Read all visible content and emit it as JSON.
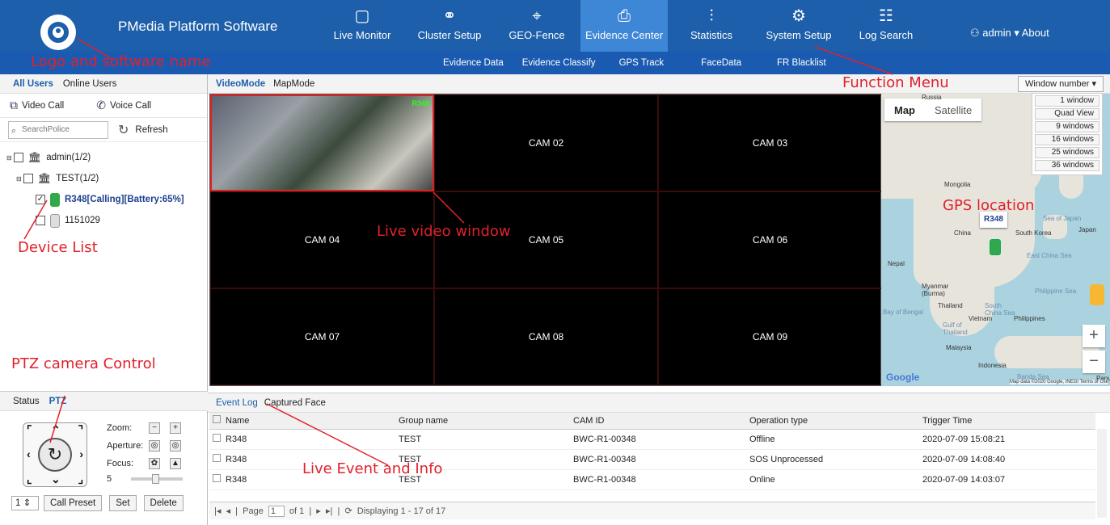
{
  "header": {
    "app_title": "PMedia Platform Software",
    "nav": [
      {
        "label": "Live Monitor",
        "icon": "monitor-icon",
        "glyph": "▢"
      },
      {
        "label": "Cluster Setup",
        "icon": "cluster-icon",
        "glyph": "⚭"
      },
      {
        "label": "GEO-Fence",
        "icon": "geofence-icon",
        "glyph": "⌖"
      },
      {
        "label": "Evidence Center",
        "icon": "evidence-icon",
        "glyph": "⎙"
      },
      {
        "label": "Statistics",
        "icon": "statistics-icon",
        "glyph": "⫶"
      },
      {
        "label": "System Setup",
        "icon": "gear-icon",
        "glyph": "⚙"
      },
      {
        "label": "Log Search",
        "icon": "log-icon",
        "glyph": "☷"
      }
    ],
    "active_nav": "Evidence Center",
    "user": "admin",
    "about": "About",
    "subnav": [
      "Evidence Data",
      "Evidence Classify",
      "GPS Track",
      "FaceData",
      "FR Blacklist"
    ]
  },
  "annotations": {
    "logo": "Logo and software name",
    "function_menu": "Function Menu",
    "device_list": "Device List",
    "live_video": "Live video window",
    "gps": "GPS location",
    "ptz": "PTZ camera Control",
    "event": "Live Event and Info"
  },
  "left": {
    "tabs": [
      "All Users",
      "Online Users"
    ],
    "video_call": "Video Call",
    "voice_call": "Voice Call",
    "search_placeholder": "SearchPolice",
    "refresh": "Refresh",
    "tree": {
      "root": "admin(1/2)",
      "group": "TEST(1/2)",
      "device1": "R348[Calling][Battery:65%]",
      "device2": "1151029"
    },
    "ptz_tabs": [
      "Status",
      "PTZ"
    ],
    "ptz": {
      "zoom": "Zoom:",
      "aperture": "Aperture:",
      "focus": "Focus:",
      "speed": "5",
      "preset": "1",
      "call_preset": "Call Preset",
      "set": "Set",
      "delete": "Delete"
    }
  },
  "center": {
    "modes": [
      "VideoMode",
      "MapMode"
    ],
    "window_number": "Window number",
    "window_options": [
      "1 window",
      "Quad View",
      "9 windows",
      "16 windows",
      "25 windows",
      "36 windows"
    ],
    "video_label": "R348",
    "cams": [
      "CAM 02",
      "CAM 03",
      "CAM 04",
      "CAM 05",
      "CAM 06",
      "CAM 07",
      "CAM 08",
      "CAM 09"
    ],
    "map": {
      "tabs": [
        "Map",
        "Satellite"
      ],
      "marker": "R348",
      "labels": [
        "Russia",
        "Mongolia",
        "China",
        "South Korea",
        "Japan",
        "Nepal",
        "Myanmar (Burma)",
        "Thailand",
        "Vietnam",
        "Philippines",
        "Malaysia",
        "Indonesia",
        "Sea of Japan",
        "East China Sea",
        "Philippine Sea",
        "Bay of Bengal",
        "South China Sea",
        "Gulf of Thailand",
        "Banda Sea",
        "Papua"
      ],
      "google": "Google",
      "footer": "Map data ©2020 Google, INEGI  Terms of Use"
    }
  },
  "bottom": {
    "tabs": [
      "Event Log",
      "Captured Face"
    ],
    "columns": [
      "Name",
      "Group name",
      "CAM ID",
      "Operation type",
      "Trigger Time"
    ],
    "rows": [
      [
        "R348",
        "TEST",
        "BWC-R1-00348",
        "Offline",
        "2020-07-09 15:08:21"
      ],
      [
        "R348",
        "TEST",
        "BWC-R1-00348",
        "SOS Unprocessed",
        "2020-07-09 14:08:40"
      ],
      [
        "R348",
        "TEST",
        "BWC-R1-00348",
        "Online",
        "2020-07-09 14:03:07"
      ]
    ],
    "pager": {
      "page_label": "Page",
      "page": "1",
      "of": "of 1",
      "displaying": "Displaying 1 - 17 of 17"
    }
  }
}
